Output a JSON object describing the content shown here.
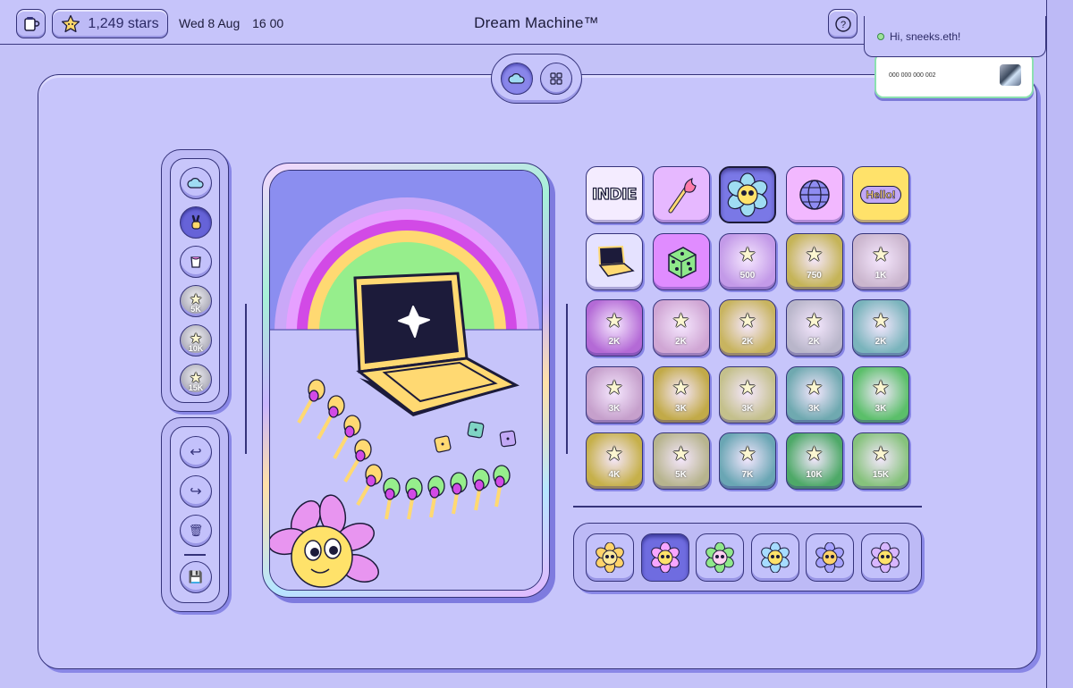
{
  "topbar": {
    "stars_label": "1,249 stars",
    "date": "Wed 8 Aug",
    "time": "16 00",
    "title": "Dream Machine™",
    "help_glyph": "?"
  },
  "wallet": {
    "greeting": "Hi, sneeks.eth!",
    "card_number": "000 000 000 002"
  },
  "tools_top": [
    {
      "name": "cloud-tool",
      "icon": "cloud-icon",
      "label": ""
    },
    {
      "name": "hand-tool",
      "icon": "peace-hand-icon",
      "label": "",
      "active": true
    },
    {
      "name": "paint-tool",
      "icon": "paint-bucket-icon",
      "label": ""
    },
    {
      "name": "level-5k-tool",
      "icon": "star-medal-icon",
      "label": "5K"
    },
    {
      "name": "level-10k-tool",
      "icon": "star-medal-icon",
      "label": "10K"
    },
    {
      "name": "level-15k-tool",
      "icon": "star-medal-icon",
      "label": "15K"
    }
  ],
  "tools_bottom": {
    "undo": "↩",
    "redo": "↪",
    "delete": "🗑",
    "save": "💾"
  },
  "stickers": [
    {
      "kind": "indie",
      "text": "INDIE",
      "bg": "#f4ecff"
    },
    {
      "kind": "match",
      "bg": "#e6b8ff"
    },
    {
      "kind": "flower",
      "bg": "#7a78e6",
      "selected": true
    },
    {
      "kind": "globe",
      "bg": "#f2b8ff"
    },
    {
      "kind": "hello",
      "text": "Hello!",
      "bg": "#ffe26a"
    },
    {
      "kind": "laptop",
      "bg": "#e5e2ff"
    },
    {
      "kind": "dice",
      "bg": "#e08cff"
    },
    {
      "kind": "star",
      "label": "500",
      "bg": "#c39ae8"
    },
    {
      "kind": "star",
      "label": "750",
      "bg": "#c5b458"
    },
    {
      "kind": "star",
      "label": "1K",
      "bg": "#cbb6ce"
    },
    {
      "kind": "star",
      "label": "2K",
      "bg": "#b46ad6"
    },
    {
      "kind": "star",
      "label": "2K",
      "bg": "#d0a6d4"
    },
    {
      "kind": "star",
      "label": "2K",
      "bg": "#c8b460"
    },
    {
      "kind": "star",
      "label": "2K",
      "bg": "#b9b6ca"
    },
    {
      "kind": "star",
      "label": "2K",
      "bg": "#7ab4bc"
    },
    {
      "kind": "star",
      "label": "3K",
      "bg": "#c6a0cc"
    },
    {
      "kind": "star",
      "label": "3K",
      "bg": "#c2aa48"
    },
    {
      "kind": "star",
      "label": "3K",
      "bg": "#c4c08c"
    },
    {
      "kind": "star",
      "label": "3K",
      "bg": "#6fa9b0"
    },
    {
      "kind": "star",
      "label": "3K",
      "bg": "#5bbf6a"
    },
    {
      "kind": "star",
      "label": "4K",
      "bg": "#c6b04a"
    },
    {
      "kind": "star",
      "label": "5K",
      "bg": "#b7b48e"
    },
    {
      "kind": "star",
      "label": "7K",
      "bg": "#6aa6b4"
    },
    {
      "kind": "star",
      "label": "10K",
      "bg": "#4ea968"
    },
    {
      "kind": "star",
      "label": "15K",
      "bg": "#86c27c"
    }
  ],
  "flower_tray": [
    {
      "petal": "#ffd36a",
      "center": "#ffe89a"
    },
    {
      "petal": "#f7a6ff",
      "center": "#ffe26a",
      "active": true
    },
    {
      "petal": "#8fe88a",
      "center": "#ffd0f2"
    },
    {
      "petal": "#a6dcff",
      "center": "#ffe26a"
    },
    {
      "petal": "#a6a2ff",
      "center": "#ffd36a"
    },
    {
      "petal": "#d8b6ff",
      "center": "#ffe26a"
    }
  ],
  "colors": {
    "background": "#c4c2f8",
    "accent": "#6663d8",
    "outline": "#35337a"
  }
}
